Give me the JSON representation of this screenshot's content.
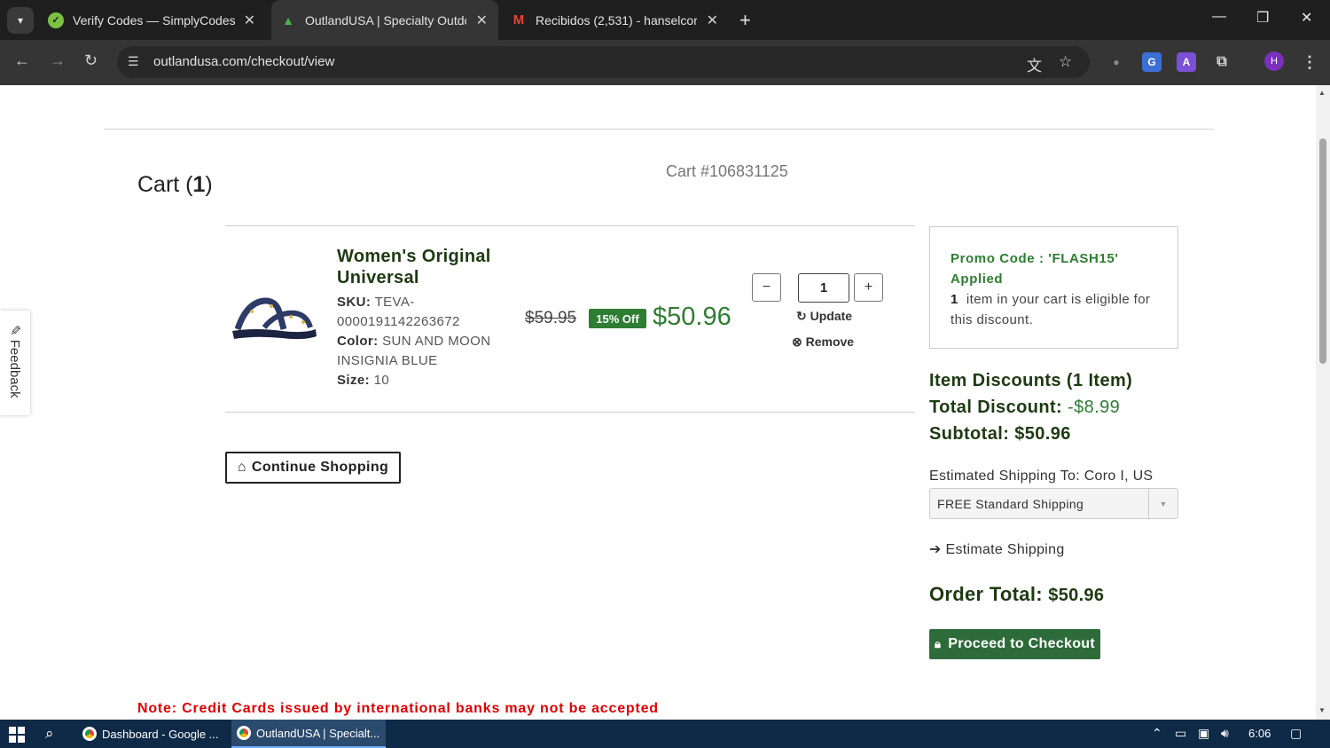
{
  "browser": {
    "tabs": [
      {
        "title": "Verify Codes — SimplyCodes",
        "active": false
      },
      {
        "title": "OutlandUSA | Specialty Outdoo",
        "active": true
      },
      {
        "title": "Recibidos (2,531) - hanselcoron",
        "active": false
      }
    ],
    "new_tab": "+",
    "url": "outlandusa.com/checkout/view",
    "profile_initial": "H"
  },
  "cart": {
    "title": "Cart",
    "count": "1",
    "cart_number": "Cart #106831125"
  },
  "item": {
    "name": "Women's Original Universal",
    "sku_label": "SKU:",
    "sku": "TEVA-0000191142263672",
    "color_label": "Color:",
    "color": "SUN AND MOON INSIGNIA BLUE",
    "size_label": "Size:",
    "size": "10",
    "old_price": "$59.95",
    "discount_badge": "15% Off",
    "new_price": "$50.96",
    "quantity": "1",
    "update_label": "Update",
    "remove_label": "Remove"
  },
  "actions": {
    "continue_shopping": "Continue Shopping",
    "proceed_checkout": "Proceed to Checkout",
    "estimate_shipping": "Estimate Shipping"
  },
  "promo": {
    "title": "Promo Code : 'FLASH15' Applied",
    "count": "1",
    "text": "item in your cart is eligible for this discount."
  },
  "summary": {
    "item_discounts": "Item Discounts (1 Item)",
    "total_discount_label": "Total Discount:",
    "total_discount": "-$8.99",
    "subtotal_label": "Subtotal:",
    "subtotal": "$50.96",
    "shipping_label": "Estimated Shipping To: Coro I, US",
    "shipping_option": "FREE Standard Shipping",
    "order_total_label": "Order Total:",
    "order_total": "$50.96"
  },
  "note": "Note: Credit Cards issued by international banks may not be accepted",
  "feedback": "Feedback",
  "taskbar": {
    "apps": [
      {
        "title": "Dashboard - Google ..."
      },
      {
        "title": "OutlandUSA | Specialt..."
      }
    ],
    "time": "6:06"
  },
  "colors": {
    "brand_green": "#2e7d32",
    "checkout_green": "#2e6b3a",
    "note_red": "#dd0000"
  }
}
